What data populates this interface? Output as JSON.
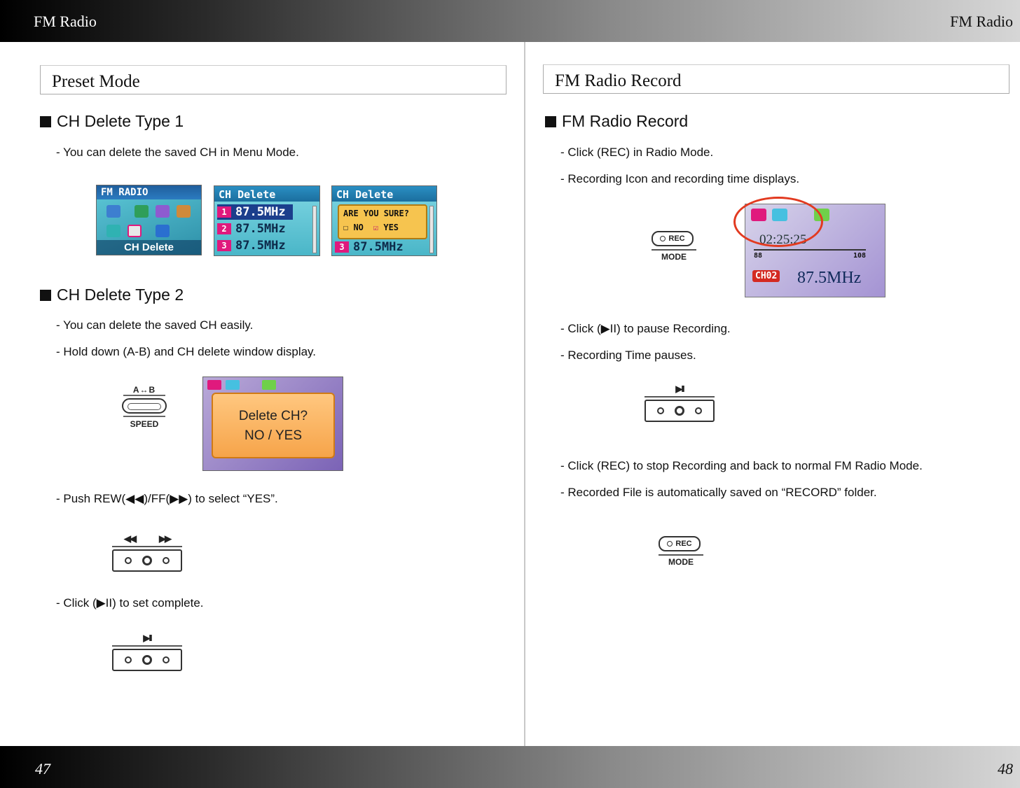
{
  "header": {
    "left": "FM Radio",
    "right": "FM Radio"
  },
  "footer": {
    "left_page": "47",
    "right_page": "48"
  },
  "left": {
    "section_title": "Preset Mode",
    "type1": {
      "heading": "CH Delete Type 1",
      "lines": [
        "- You can delete the saved CH in Menu Mode."
      ],
      "screens": {
        "menu_title": "FM RADIO",
        "menu_label": "CH Delete",
        "delete_title": "CH Delete",
        "rows": [
          {
            "num": "1",
            "freq": "87.5MHz"
          },
          {
            "num": "2",
            "freq": "87.5MHz"
          },
          {
            "num": "3",
            "freq": "87.5MHz"
          }
        ],
        "confirm_title": "CH Delete",
        "confirm_question": "ARE YOU SURE?",
        "confirm_no": "NO",
        "confirm_yes": "YES",
        "confirm_row_num": "3",
        "confirm_row_freq": "87.5MHz"
      }
    },
    "type2": {
      "heading": "CH Delete Type 2",
      "lines": [
        "- You can delete the saved CH easily.",
        "- Hold down (A-B) and CH delete window display."
      ],
      "ab_button": {
        "top": "A↔B",
        "bottom": "SPEED"
      },
      "dialog_line1": "Delete CH?",
      "dialog_line2": "NO / YES",
      "push_line": "- Push REW(◀◀)/FF(▶▶) to select “YES”.",
      "rew_icon": "◀◀",
      "ff_icon": "▶▶",
      "click_line": "- Click (▶II) to set complete.",
      "play_icon": "▶II"
    }
  },
  "right": {
    "section_title": "FM Radio Record",
    "heading": "FM Radio Record",
    "lines1": [
      "- Click (REC) in Radio Mode.",
      "- Recording Icon and recording time displays."
    ],
    "rec_button": {
      "cap": "REC",
      "mode": "MODE"
    },
    "radio_screen": {
      "time": "02:25:25",
      "scale_min": "88",
      "scale_max": "108",
      "channel": "CH02",
      "freq": "87.5MHz"
    },
    "lines2": [
      "- Click (▶II) to pause Recording.",
      "- Recording Time pauses."
    ],
    "play_icon": "▶II",
    "lines3": [
      "- Click (REC) to stop Recording and back to normal FM Radio Mode.",
      "- Recorded File is automatically saved on “RECORD” folder."
    ]
  },
  "colors": {
    "accent_pink": "#e0197d",
    "record_ring": "#e23a20",
    "dialog_orange": "#f6a44a"
  }
}
